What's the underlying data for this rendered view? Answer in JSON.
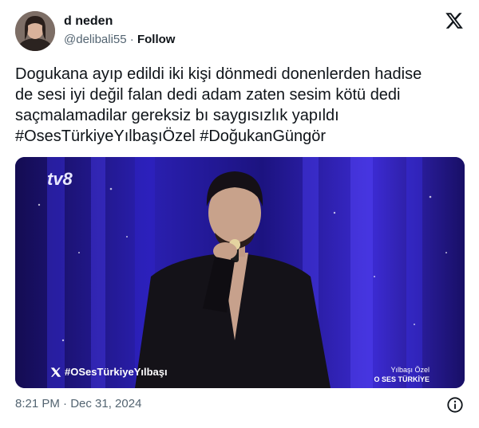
{
  "user": {
    "display_name": "d neden",
    "handle": "@delibali55",
    "separator": "·",
    "follow_label": "Follow",
    "avatar_icon": "user-avatar"
  },
  "brand_icon": "x-logo-icon",
  "tweet": {
    "text": "Dogukana ayıp edildi iki kişi dönmedi donenlerden hadise\nde sesi iyi değil falan dedi adam zaten sesim kötü dedi\nsaçmalamadilar gereksiz bı saygısızlık yapıldı\n#OsesTürkiyeYılbaşıÖzel #DoğukanGüngör"
  },
  "media": {
    "channel_logo": "tv8",
    "hashtag_overlay": "#OSesTürkiyeYılbaşı",
    "brand_line1": "Yılbaşı Özel",
    "brand_line2": "O SES TÜRKİYE"
  },
  "footer": {
    "timestamp": "8:21 PM · Dec 31, 2024",
    "info_icon": "info-icon"
  },
  "colors": {
    "text": "#0f1419",
    "secondary": "#536471",
    "stage_blue": "#2a1fb0"
  }
}
